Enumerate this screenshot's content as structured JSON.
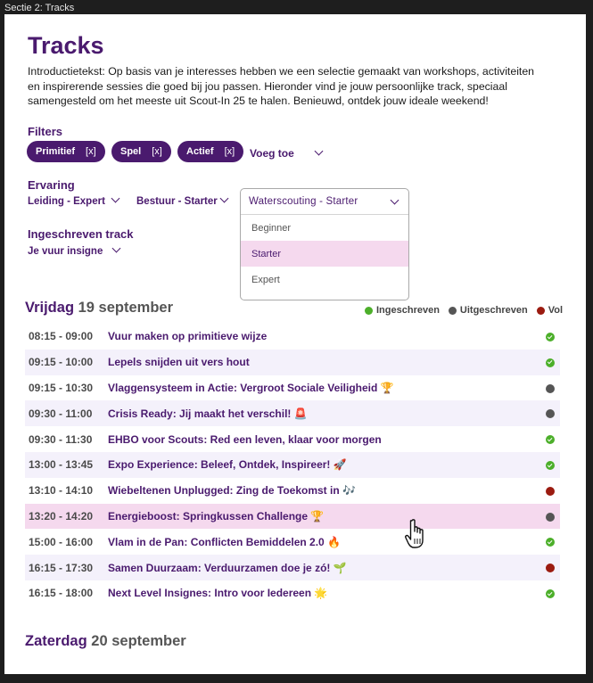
{
  "frame_label": "Sectie 2: Tracks",
  "title": "Tracks",
  "intro": "Introductietekst: Op basis van je interesses hebben we een selectie gemaakt van workshops, activiteiten en inspirerende sessies die goed bij jou passen. Hieronder vind je jouw persoonlijke track, speciaal samengesteld om het meeste uit Scout-In 25 te halen. Benieuwd, ontdek jouw ideale weekend!",
  "filters": {
    "label": "Filters",
    "chips": [
      {
        "label": "Primitief",
        "remove": "[x]"
      },
      {
        "label": "Spel",
        "remove": "[x]"
      },
      {
        "label": "Actief",
        "remove": "[x]"
      }
    ],
    "add_label": "Voeg toe"
  },
  "ervaring": {
    "label": "Ervaring",
    "dropdowns": [
      "Leiding - Expert",
      "Bestuur - Starter"
    ],
    "open_select": {
      "value": "Waterscouting - Starter",
      "options": [
        "Beginner",
        "Starter",
        "Expert"
      ],
      "selected": "Starter"
    }
  },
  "track": {
    "label": "Ingeschreven track",
    "value": "Je vuur insigne"
  },
  "legend": [
    {
      "label": "Ingeschreven",
      "color": "#4caf2a"
    },
    {
      "label": "Uitgeschreven",
      "color": "#555555"
    },
    {
      "label": "Vol",
      "color": "#9b1b10"
    }
  ],
  "days": [
    {
      "day": "Vrijdag",
      "date": "19 september",
      "sessions": [
        {
          "time": "08:15 - 09:00",
          "title": "Vuur maken op primitieve wijze",
          "status": "ingeschreven"
        },
        {
          "time": "09:15 - 10:00",
          "title": "Lepels snijden uit vers hout",
          "status": "ingeschreven"
        },
        {
          "time": "09:15 - 10:30",
          "title": "Vlaggensysteem in Actie: Vergroot Sociale Veiligheid 🏆",
          "status": "uitgeschreven"
        },
        {
          "time": "09:30 - 11:00",
          "title": "Crisis Ready: Jij maakt het verschil! 🚨",
          "status": "uitgeschreven"
        },
        {
          "time": "09:30 - 11:30",
          "title": "EHBO voor Scouts: Red een leven, klaar voor morgen",
          "status": "ingeschreven"
        },
        {
          "time": "13:00 - 13:45",
          "title": "Expo Experience: Beleef, Ontdek, Inspireer! 🚀",
          "status": "ingeschreven"
        },
        {
          "time": "13:10 - 14:10",
          "title": "Wiebeltenen Unplugged: Zing de Toekomst in 🎶",
          "status": "vol"
        },
        {
          "time": "13:20 - 14:20",
          "title": "Energieboost: Springkussen Challenge 🏆",
          "status": "uitgeschreven"
        },
        {
          "time": "15:00 - 16:00",
          "title": "Vlam in de Pan: Conflicten Bemiddelen 2.0 🔥",
          "status": "ingeschreven"
        },
        {
          "time": "16:15 - 17:30",
          "title": "Samen Duurzaam: Verduurzamen doe je zó! 🌱",
          "status": "vol"
        },
        {
          "time": "16:15 - 18:00",
          "title": "Next Level Insignes: Intro voor Iedereen 🌟",
          "status": "ingeschreven"
        }
      ]
    },
    {
      "day": "Zaterdag",
      "date": "20 september",
      "sessions": []
    }
  ]
}
